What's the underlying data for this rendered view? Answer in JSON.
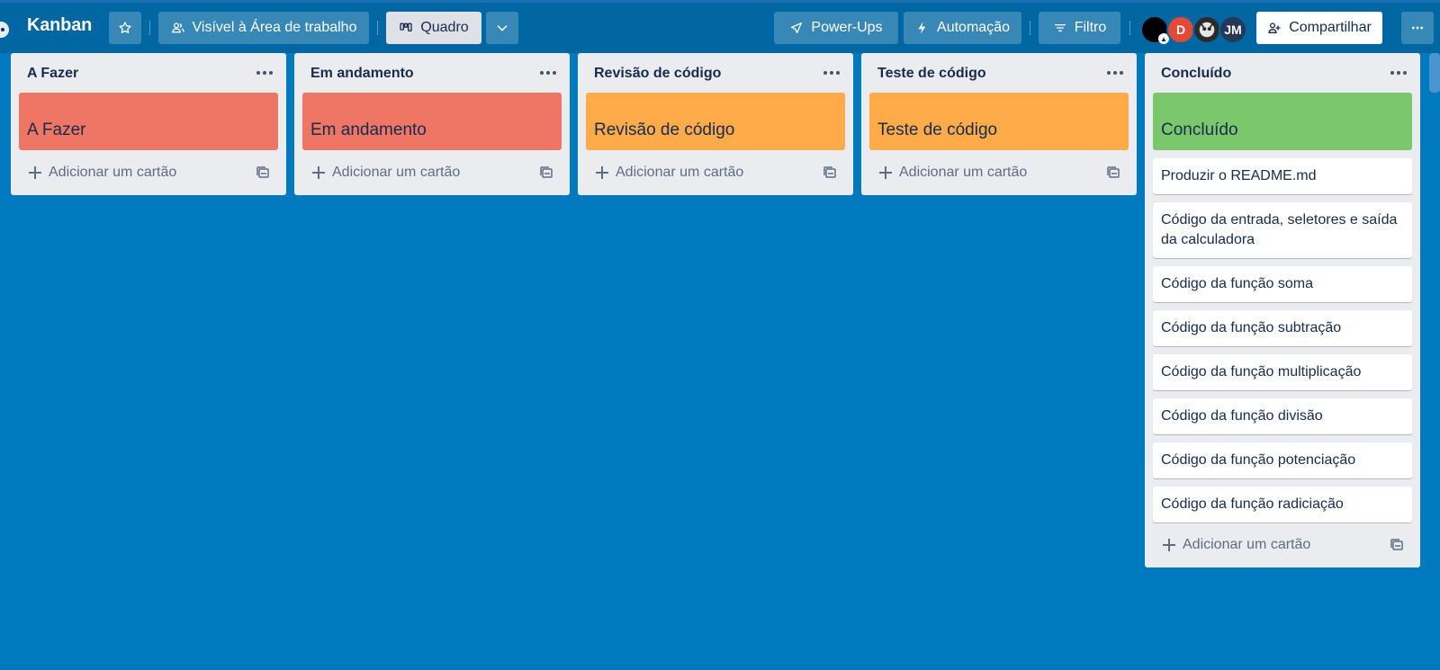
{
  "header": {
    "board_title": "Kanban",
    "visibility_label": "Visível à Área de trabalho",
    "view_label": "Quadro",
    "powerups_label": "Power-Ups",
    "automation_label": "Automação",
    "filter_label": "Filtro",
    "share_label": "Compartilhar",
    "avatars": [
      "",
      "D",
      "",
      "JM"
    ]
  },
  "colors": {
    "board_bg": "#0079bf",
    "header_bg": "#0067a3",
    "red_cover": "#ef7564",
    "orange_cover": "#ffab4a",
    "green_cover": "#7bc86c"
  },
  "lists": [
    {
      "title": "A Fazer",
      "cover_label": "A Fazer",
      "cover_color": "#ef7564",
      "add_card": "Adicionar um cartão",
      "cards": []
    },
    {
      "title": "Em andamento",
      "cover_label": "Em andamento",
      "cover_color": "#ef7564",
      "add_card": "Adicionar um cartão",
      "cards": []
    },
    {
      "title": "Revisão de código",
      "cover_label": "Revisão de código",
      "cover_color": "#ffab4a",
      "add_card": "Adicionar um cartão",
      "cards": []
    },
    {
      "title": "Teste de código",
      "cover_label": "Teste de código",
      "cover_color": "#ffab4a",
      "add_card": "Adicionar um cartão",
      "cards": []
    },
    {
      "title": "Concluído",
      "cover_label": "Concluído",
      "cover_color": "#7bc86c",
      "add_card": "Adicionar um cartão",
      "cards": [
        "Produzir o README.md",
        "Código da entrada, seletores e saída da calculadora",
        "Código da função soma",
        "Código da função subtração",
        "Código da função multiplicação",
        "Código da função divisão",
        "Código da função potenciação",
        "Código da função radiciação"
      ]
    }
  ]
}
